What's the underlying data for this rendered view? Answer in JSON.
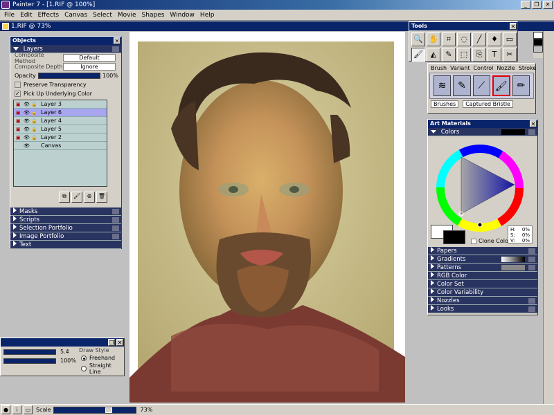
{
  "app": {
    "title": "Painter 7 - [1.RIF @ 100%]",
    "doc_title": "1.RIF @ 73%"
  },
  "menu": [
    "File",
    "Edit",
    "Effects",
    "Canvas",
    "Select",
    "Movie",
    "Shapes",
    "Window",
    "Help"
  ],
  "objects": {
    "title": "Objects",
    "layers_label": "Layers",
    "composite_method_label": "Composite Method",
    "composite_method_value": "Default",
    "composite_depth_label": "Composite Depth",
    "composite_depth_value": "Ignore",
    "opacity_label": "Opacity",
    "opacity_value": "100%",
    "preserve_transparency": "Preserve Transparency",
    "pick_up_underlying": "Pick Up Underlying Color",
    "layers": [
      "Layer 3",
      "Layer 6",
      "Layer 4",
      "Layer 5",
      "Layer 2",
      "Canvas"
    ],
    "selected_layer": "Layer 6",
    "sections": [
      "Masks",
      "Scripts",
      "Selection Portfolio",
      "Image Portfolio",
      "Text"
    ]
  },
  "tools": {
    "title": "Tools",
    "icons": [
      "magnifier-icon",
      "hand-icon",
      "crop-icon",
      "lasso-icon",
      "pen-icon",
      "dropper-icon",
      "rectangle-icon",
      "brush-icon",
      "bucket-icon",
      "eyedropper-icon",
      "rect-select-icon",
      "clone-icon",
      "text-icon",
      "scissors-icon"
    ]
  },
  "brushes": {
    "tabs": [
      "Brush",
      "Variant",
      "Control",
      "Nozzle",
      "Stroke"
    ],
    "category": "Brushes",
    "variant": "Captured Bristle"
  },
  "art_materials": {
    "title": "Art Materials",
    "colors_label": "Colors",
    "clone_color_label": "Clone Color",
    "hsv": {
      "h": "0%",
      "s": "0%",
      "v": "0%"
    },
    "sections": [
      "Papers",
      "Gradients",
      "Patterns",
      "RGB Color",
      "Color Set",
      "Color Variability",
      "Nozzles",
      "Looks"
    ]
  },
  "drawstyle": {
    "size_value": "5.4",
    "opacity_value": "100%",
    "label": "Draw Style",
    "options": [
      "Freehand",
      "Straight Line"
    ],
    "selected": "Freehand"
  },
  "status": {
    "scale_label": "Scale",
    "zoom": "73%"
  },
  "colors": {
    "titlebar": "#0a246a",
    "panel_section": "#2a3460",
    "layer_selected": "#a9a6f0",
    "layer_bg": "#bcd0cf"
  }
}
